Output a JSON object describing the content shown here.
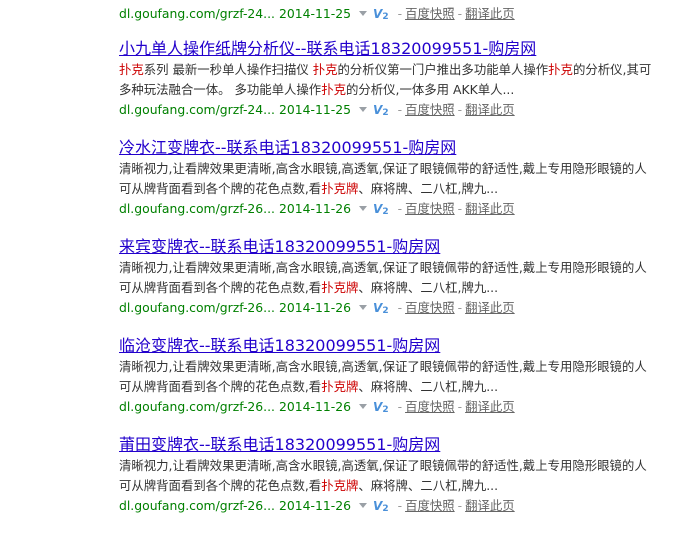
{
  "top_partial": {
    "url": "dl.goufang.com/grzf-24...",
    "date": "2014-11-25",
    "badge": "V",
    "badge_sub": "2",
    "separator": "-",
    "cache_link": "百度快照",
    "translate_link": "翻译此页"
  },
  "results": [
    {
      "title": "小九单人操作纸牌分析仪--联系电话18320099551-购房网",
      "abstract_parts": [
        {
          "hl": "扑克"
        },
        {
          "t": "系列 最新一秒单人操作扫描仪 "
        },
        {
          "hl": "扑克"
        },
        {
          "t": "的分析仪第一门户推出多功能单人操作"
        },
        {
          "hl": "扑克"
        },
        {
          "t": "的分析仪,其可多种玩法融合一体。 多功能单人操作"
        },
        {
          "hl": "扑克"
        },
        {
          "t": "的分析仪,一体多用 AKK单人..."
        }
      ],
      "url": "dl.goufang.com/grzf-24...",
      "date": "2014-11-25",
      "cache_link": "百度快照",
      "translate_link": "翻译此页"
    },
    {
      "title": "冷水江变牌衣--联系电话18320099551-购房网",
      "abstract_parts": [
        {
          "t": "清晰视力,让看牌效果更清晰,高含水眼镜,高透氧,保证了眼镜佩带的舒适性,戴上专用隐形眼镜的人可从牌背面看到各个牌的花色点数,看"
        },
        {
          "hl": "扑克牌"
        },
        {
          "t": "、麻将牌、二八杠,牌九..."
        }
      ],
      "url": "dl.goufang.com/grzf-26...",
      "date": "2014-11-26",
      "cache_link": "百度快照",
      "translate_link": "翻译此页"
    },
    {
      "title": "来宾变牌衣--联系电话18320099551-购房网",
      "abstract_parts": [
        {
          "t": "清晰视力,让看牌效果更清晰,高含水眼镜,高透氧,保证了眼镜佩带的舒适性,戴上专用隐形眼镜的人可从牌背面看到各个牌的花色点数,看"
        },
        {
          "hl": "扑克牌"
        },
        {
          "t": "、麻将牌、二八杠,牌九..."
        }
      ],
      "url": "dl.goufang.com/grzf-26...",
      "date": "2014-11-26",
      "cache_link": "百度快照",
      "translate_link": "翻译此页"
    },
    {
      "title": "临沧变牌衣--联系电话18320099551-购房网",
      "abstract_parts": [
        {
          "t": "清晰视力,让看牌效果更清晰,高含水眼镜,高透氧,保证了眼镜佩带的舒适性,戴上专用隐形眼镜的人可从牌背面看到各个牌的花色点数,看"
        },
        {
          "hl": "扑克牌"
        },
        {
          "t": "、麻将牌、二八杠,牌九..."
        }
      ],
      "url": "dl.goufang.com/grzf-26...",
      "date": "2014-11-26",
      "cache_link": "百度快照",
      "translate_link": "翻译此页"
    },
    {
      "title": "莆田变牌衣--联系电话18320099551-购房网",
      "abstract_parts": [
        {
          "t": "清晰视力,让看牌效果更清晰,高含水眼镜,高透氧,保证了眼镜佩带的舒适性,戴上专用隐形眼镜的人可从牌背面看到各个牌的花色点数,看"
        },
        {
          "hl": "扑克牌"
        },
        {
          "t": "、麻将牌、二八杠,牌九..."
        }
      ],
      "url": "dl.goufang.com/grzf-26...",
      "date": "2014-11-26",
      "cache_link": "百度快照",
      "translate_link": "翻译此页"
    }
  ],
  "colors": {
    "title_link": "#2200cc",
    "highlight": "#cc0000",
    "url_green": "#008000",
    "meta_gray": "#666666",
    "badge_blue": "#4a90d9"
  }
}
